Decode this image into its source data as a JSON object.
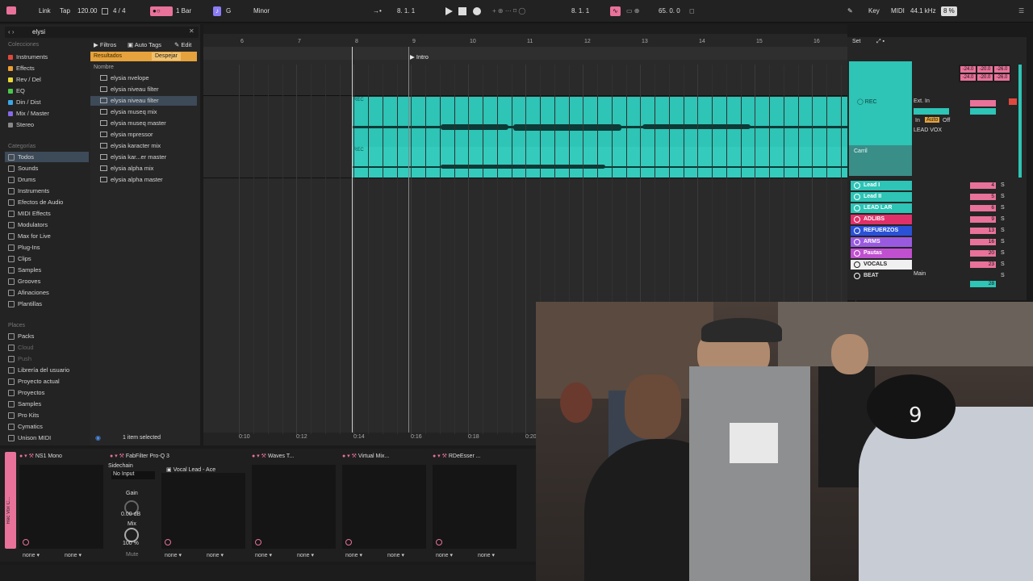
{
  "transport": {
    "link": "Link",
    "tap": "Tap",
    "tempo": "120.00",
    "meter": "4 / 4",
    "quantize": "1 Bar",
    "key": "G",
    "scale": "Minor",
    "position": "8. 1. 1",
    "loop_start": "8. 1. 1",
    "loop_length": "65. 0. 0",
    "key_label": "Key",
    "midi_label": "MIDI",
    "sample_rate": "44.1 kHz",
    "cpu": "8 %"
  },
  "browser": {
    "search": "elysi",
    "collections_title": "Colecciones",
    "collections": [
      {
        "label": "Instruments",
        "color": "#e0483e"
      },
      {
        "label": "Effects",
        "color": "#f0a030"
      },
      {
        "label": "Rev / Del",
        "color": "#e8d838"
      },
      {
        "label": "EQ",
        "color": "#48c848"
      },
      {
        "label": "Din / Dist",
        "color": "#38a8e8"
      },
      {
        "label": "Mix / Master",
        "color": "#8868e8"
      },
      {
        "label": "Stereo",
        "color": "#888888"
      }
    ],
    "categories_title": "Categorías",
    "categories": [
      "Todos",
      "Sounds",
      "Drums",
      "Instruments",
      "Efectos de Audio",
      "MIDI Effects",
      "Modulators",
      "Max for Live",
      "Plug-Ins",
      "Clips",
      "Samples",
      "Grooves",
      "Afinaciones",
      "Plantillas"
    ],
    "places_title": "Places",
    "places": [
      "Packs",
      "Cloud",
      "Push",
      "Librería del usuario",
      "Proyecto actual",
      "Proyectos",
      "Samples",
      "Pro Kits",
      "Cymatics",
      "Unison MIDI"
    ],
    "filter_label": "Filtros",
    "autotags_label": "Auto Tags",
    "edit_label": "Edit",
    "results_label": "Resultados",
    "clear_label": "Despejar",
    "name_header": "Nombre",
    "results": [
      "elysia nvelope",
      "elysia niveau filter",
      "elysia niveau filter",
      "elysia museq mix",
      "elysia museq master",
      "elysia mpressor",
      "elysia karacter mix",
      "elysia kar...er master",
      "elysia alpha mix",
      "elysia alpha master"
    ],
    "status": "1 item selected"
  },
  "arrangement": {
    "bar_numbers": [
      "6",
      "7",
      "8",
      "9",
      "10",
      "11",
      "12",
      "13",
      "14",
      "15",
      "16"
    ],
    "locator": "Intro",
    "clip_label_1": "REC",
    "clip_label_2": "REC",
    "time_labels": [
      "0:10",
      "0:12",
      "0:14",
      "0:16",
      "0:18",
      "0:20"
    ]
  },
  "mixer": {
    "set_label": "Set",
    "meter_vals": [
      "-24.0",
      "-20.0",
      "-26.0",
      "-24.0",
      "-20.0",
      "-26.0"
    ],
    "track_rec": "REC",
    "ext_in": "Ext. In",
    "in_label": "In",
    "auto_label": "Auto",
    "off_label": "Off",
    "lead_vox": "LEAD VOX",
    "carril": "Carril",
    "tracks": [
      {
        "name": "Lead I",
        "color": "#2ec4b6",
        "vol": "4"
      },
      {
        "name": "Lead II",
        "color": "#2ec4b6",
        "vol": "5"
      },
      {
        "name": "LEAD LAR",
        "color": "#2ec4b6",
        "vol": "6"
      },
      {
        "name": "ADLIBS",
        "color": "#e0306a",
        "vol": "9"
      },
      {
        "name": "REFUERZOS",
        "color": "#2a52d8",
        "vol": "13"
      },
      {
        "name": "ARMS",
        "color": "#9a5ae0",
        "vol": "16"
      },
      {
        "name": "Pautas",
        "color": "#c050d0",
        "vol": "20"
      },
      {
        "name": "VOCALS",
        "color": "#f0f0f0",
        "vol": "23"
      },
      {
        "name": "BEAT",
        "color": "#252525",
        "vol": "28"
      }
    ],
    "main_label": "Main",
    "solo": "S"
  },
  "devices": {
    "chain_label": "Rec Vox C...",
    "items": [
      {
        "name": "NS1 Mono"
      },
      {
        "name": "FabFilter Pro-Q 3"
      },
      {
        "name": "Waves T..."
      },
      {
        "name": "Virtual Mix..."
      },
      {
        "name": "RDeEsser ..."
      }
    ],
    "sidechain": "Sidechain",
    "no_input": "No Input",
    "preset": "Vocal Lead - Ace",
    "gain": "Gain",
    "gain_val": "0.00 dB",
    "mix": "Mix",
    "mix_val": "100 %",
    "mute": "Mute",
    "none": "none"
  }
}
